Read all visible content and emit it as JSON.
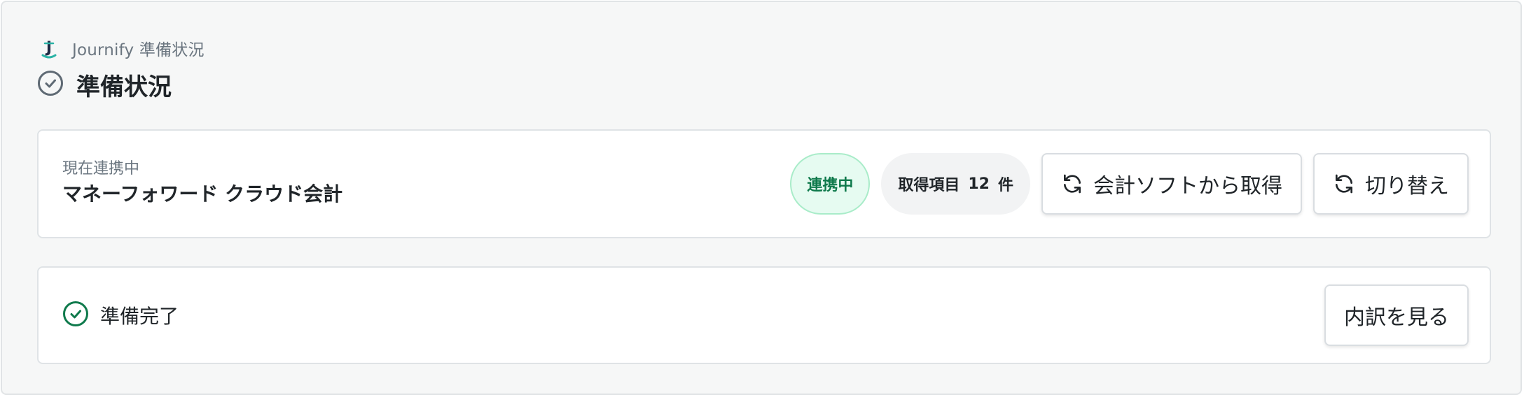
{
  "header": {
    "app_title": "Journify 準備状況",
    "page_title": "準備状況"
  },
  "integration": {
    "label": "現在連携中",
    "name": "マネーフォワード クラウド会計",
    "connected_badge": "連携中",
    "count_label": "取得項目",
    "count_value": "12",
    "count_unit": "件",
    "fetch_button": "会計ソフトから取得",
    "switch_button": "切り替え"
  },
  "status": {
    "text": "準備完了",
    "details_button": "内訳を見る"
  },
  "colors": {
    "accent_green": "#0f7a4c",
    "badge_bg": "#e6fbf1",
    "badge_border": "#a9ecc9",
    "text_primary": "#202529",
    "text_secondary": "#6b7680"
  },
  "icons": {
    "logo": "journify-logo-icon",
    "title": "check-circle-icon",
    "fetch": "refresh-icon",
    "switch": "refresh-icon",
    "status": "check-circle-icon"
  }
}
